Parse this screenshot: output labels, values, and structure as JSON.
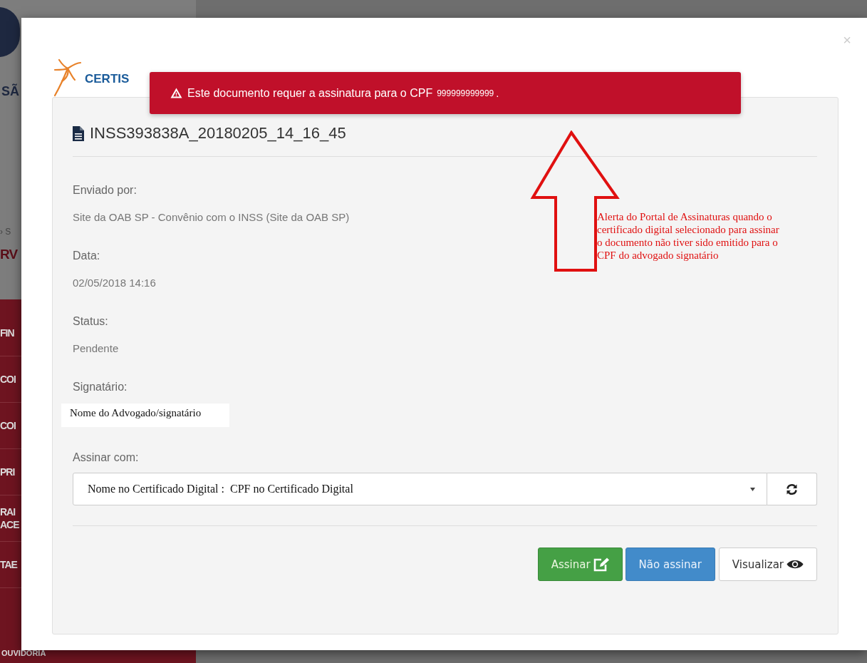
{
  "background_page": {
    "logo_fragment": "SÃ",
    "breadcrumb_fragment": "› S",
    "heading_fragment": "RV",
    "menu_items": [
      [
        "FIN"
      ],
      [
        "COI"
      ],
      [
        "COI"
      ],
      [
        "PRI"
      ],
      [
        "RAI",
        "ACE"
      ],
      [
        "TAE"
      ]
    ],
    "footer_item": "OUVIDORIA"
  },
  "modal": {
    "close": "×",
    "logo_text": "CERTIS",
    "alert": {
      "text": "Este documento requer a assinatura para o CPF",
      "cpf": "999999999999",
      "end": "."
    },
    "document_title": "INSS393838A_20180205_14_16_45",
    "fields": [
      {
        "label": "Enviado por:",
        "value": "Site da OAB SP - Convênio com o INSS (Site da OAB SP)",
        "kind": "text"
      },
      {
        "label": "Data:",
        "value": "02/05/2018 14:16",
        "kind": "text"
      },
      {
        "label": "Status:",
        "value": "Pendente",
        "kind": "text"
      },
      {
        "label": "Signatário:",
        "value": "Nome do Advogado/signatário",
        "kind": "pasted"
      }
    ],
    "sign_with": {
      "label": "Assinar com:",
      "value": "Nome no Certificado Digital :  CPF no Certificado Digital"
    },
    "buttons": [
      {
        "label": "Assinar",
        "kind": "success"
      },
      {
        "label": "Não assinar",
        "kind": "primary"
      },
      {
        "label": "Visualizar",
        "kind": "default"
      }
    ]
  },
  "annotation": {
    "text": "Alerta do Portal de Assinaturas quando o certificado digital selecionado para assinar o documento não tiver sido emitido para o CPF do advogado signatário"
  }
}
